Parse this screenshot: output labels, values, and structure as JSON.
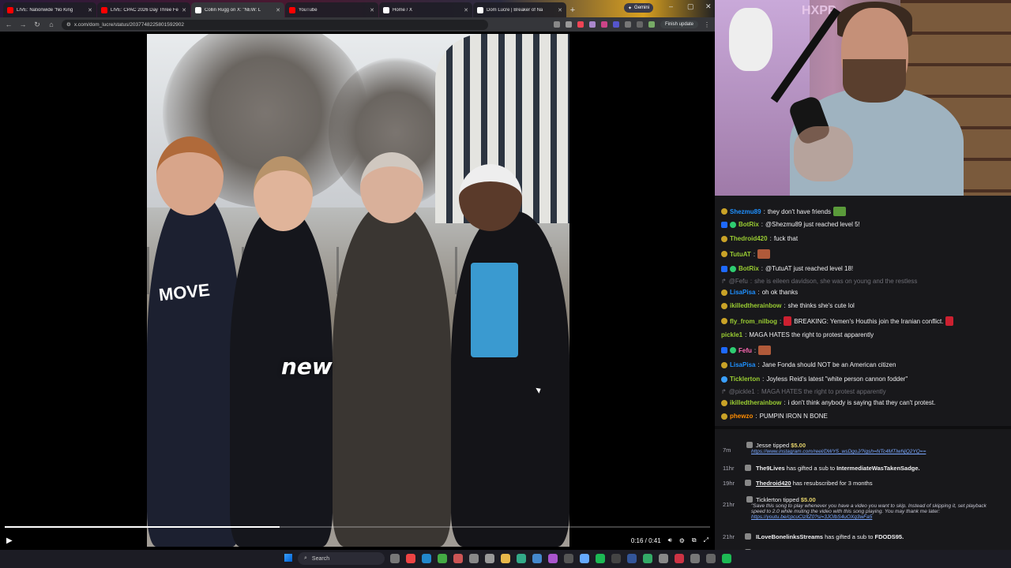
{
  "browser": {
    "tabs": [
      {
        "title": "LIVE: Nationwide \"No King",
        "color": "#ff0000"
      },
      {
        "title": "LIVE: CPAC 2026 Day Three Fe",
        "color": "#ff0000"
      },
      {
        "title": "Collin Rugg on X: \"NEW: L",
        "color": "#ffffff"
      },
      {
        "title": "YouTube",
        "color": "#ff0000"
      },
      {
        "title": "Home / X",
        "color": "#ffffff"
      },
      {
        "title": "Dom Lucre | Breaker of Na",
        "color": "#ffffff"
      }
    ],
    "gemini_label": "Gemini",
    "url": "x.com/dom_lucre/status/2037748225801592902",
    "finish_update": "Finish update"
  },
  "video": {
    "caption": "new",
    "shirt_text": "MOVE",
    "time": "0:16 / 0:41",
    "progress": 0.39
  },
  "cam": {
    "sign": "HXPP"
  },
  "chat": [
    {
      "user": "Shezmu89",
      "text": "they don't have friends",
      "color": "#1e90ff",
      "badge": "#c9a227",
      "emote": "#5a9a3a"
    },
    {
      "user": "BotRix",
      "text": "@Shezmu89 just reached level 5!",
      "color": "#9acd32",
      "badge": "#1e69ff",
      "bot": true
    },
    {
      "user": "Thedroid420",
      "text": "fuck that",
      "color": "#9acd32",
      "badge": "#c9a227"
    },
    {
      "user": "TutuAT",
      "text": "",
      "color": "#9acd32",
      "badge": "#c9a227",
      "emote": "#b05a3a"
    },
    {
      "user": "BotRix",
      "text": "@TutuAT just reached level 18!",
      "color": "#9acd32",
      "badge": "#1e69ff",
      "bot": true
    },
    {
      "user": "@Fefu",
      "text": "she is eileen davidson, she was on young and the restless",
      "reply": true
    },
    {
      "user": "LisaPisa",
      "text": "oh ok thanks",
      "color": "#1e90ff",
      "badge": "#c9a227"
    },
    {
      "user": "ikilledtherainbow",
      "text": "she thinks she's cute lol",
      "color": "#9acd32",
      "badge": "#c9a227"
    },
    {
      "user": "fly_from_nilbog",
      "text": "BREAKING: Yemen's Houthis join the Iranian conflict.",
      "color": "#9acd32",
      "badge": "#c9a227",
      "emote": "#cc2030"
    },
    {
      "user": "pickle1",
      "text": "MAGA HATES the right to protest apparently",
      "color": "#9acd32"
    },
    {
      "user": "Fefu",
      "text": "",
      "color": "#ff69b4",
      "badge": "#c9a227",
      "emote": "#b05a3a",
      "bot": true
    },
    {
      "user": "LisaPisa",
      "text": "Jane Fonda should NOT be an American citizen",
      "color": "#1e90ff",
      "badge": "#c9a227"
    },
    {
      "user": "Ticklerton",
      "text": "Joyless Reid's latest \"white person cannon fodder\"",
      "color": "#9acd32",
      "badge": "#3aa0ff"
    },
    {
      "user": "@pickle1",
      "text": "MAGA HATES the right to protest apparently",
      "reply": true
    },
    {
      "user": "ikilledtherainbow",
      "text": "i don't think anybody is saying that they can't protest.",
      "color": "#9acd32",
      "badge": "#c9a227"
    },
    {
      "user": "phewzo",
      "text": "PUMPIN IRON N BONE",
      "color": "#ff8c00",
      "badge": "#c9a227"
    }
  ],
  "events": [
    {
      "time": "7m",
      "name": "Jesse",
      "action": "tipped",
      "amount": "$5.00",
      "sub": "https://www.instagram.com/reel/DWY5_wsDgoJ/?igsh=NTc4MTIwNjQ2YQ==",
      "link": true
    },
    {
      "time": "11hr",
      "name": "The9Lives",
      "action": "has gifted a sub to",
      "target": "IntermediateWasTakenSadge."
    },
    {
      "time": "19hr",
      "name": "Thedroid420",
      "action": "has resubscribed for 3 months",
      "underline": true
    },
    {
      "time": "21hr",
      "name": "Ticklerton",
      "action": "tipped",
      "amount": "$5.00",
      "sub": "\"Save this song to play whenever you have a video you want to skip. Instead of skipping it, set playback speed to 2.0 while muting the video with this song playing. You may thank me later:",
      "sub2": "https://youtu.be/cpcuCizltZ0?si=3JOlbS4uOXq3wFa5"
    },
    {
      "time": "21hr",
      "name": "ILoveBonelinksStreams",
      "action": "has gifted a sub to",
      "target": "FDODS95."
    },
    {
      "time": "21hr",
      "name": "ILoveBonelinksStreams",
      "action": "has gifted a sub to",
      "target": "Seinfelduh."
    }
  ],
  "taskbar": {
    "search": "Search"
  }
}
